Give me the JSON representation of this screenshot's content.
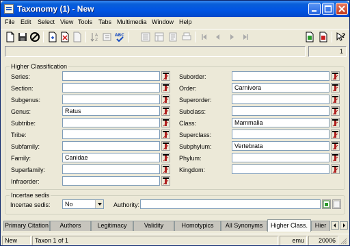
{
  "window": {
    "title": "Taxonomy (1) - New"
  },
  "menu": [
    "File",
    "Edit",
    "Select",
    "View",
    "Tools",
    "Tabs",
    "Multimedia",
    "Window",
    "Help"
  ],
  "toolbar": {
    "icons": [
      "new-document-icon",
      "save-icon",
      "cancel-icon",
      "add-record-icon",
      "delete-record-icon",
      "clear-icon",
      "sort-icon",
      "edit-icon",
      "spell-check-icon",
      "list-view-icon",
      "details-view-icon",
      "report-icon",
      "print-icon",
      "first-record-icon",
      "previous-record-icon",
      "next-record-icon",
      "last-record-icon",
      "import-icon",
      "export-icon",
      "help-icon"
    ]
  },
  "record_counter": "1",
  "higher_classification": {
    "legend": "Higher Classification",
    "left_fields": [
      {
        "label": "Series:",
        "value": ""
      },
      {
        "label": "Section:",
        "value": ""
      },
      {
        "label": "Subgenus:",
        "value": ""
      },
      {
        "label": "Genus:",
        "value": "Ratus"
      },
      {
        "label": "Subtribe:",
        "value": ""
      },
      {
        "label": "Tribe:",
        "value": ""
      },
      {
        "label": "Subfamily:",
        "value": ""
      },
      {
        "label": "Family:",
        "value": "Canidae"
      },
      {
        "label": "Superfamily:",
        "value": ""
      },
      {
        "label": "Infraorder:",
        "value": ""
      }
    ],
    "right_fields": [
      {
        "label": "Suborder:",
        "value": ""
      },
      {
        "label": "Order:",
        "value": "Carnivora"
      },
      {
        "label": "Superorder:",
        "value": ""
      },
      {
        "label": "Subclass:",
        "value": ""
      },
      {
        "label": "Class:",
        "value": "Mammalia"
      },
      {
        "label": "Superclass:",
        "value": ""
      },
      {
        "label": "Subphylum:",
        "value": "Vertebrata"
      },
      {
        "label": "Phylum:",
        "value": ""
      },
      {
        "label": "Kingdom:",
        "value": ""
      }
    ]
  },
  "incertae_sedis": {
    "legend": "Incertae sedis",
    "label": "Incertae sedis:",
    "value": "No",
    "authority_label": "Authority:",
    "authority_value": ""
  },
  "tabs": [
    {
      "label": "Primary Citation",
      "active": false
    },
    {
      "label": "Authors",
      "active": false
    },
    {
      "label": "Legitimacy",
      "active": false
    },
    {
      "label": "Validity",
      "active": false
    },
    {
      "label": "Homotypics",
      "active": false
    },
    {
      "label": "All Synonyms",
      "active": false
    },
    {
      "label": "Higher Class.",
      "active": true
    },
    {
      "label": "Hier",
      "active": false
    }
  ],
  "statusbar": {
    "mode": "New",
    "record": "Taxon 1 of 1",
    "user": "emu",
    "port": "20006"
  },
  "colors": {
    "titlebar": "#0054e3",
    "window_bg": "#ece9d8",
    "input_border": "#7f9db9"
  }
}
